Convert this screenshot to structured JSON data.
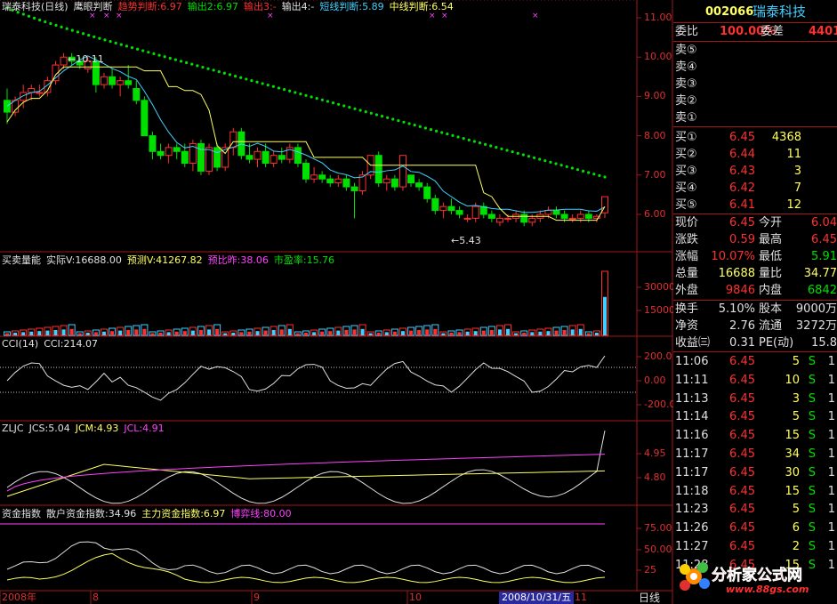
{
  "colors": {
    "up": "#ff3030",
    "down": "#00e000",
    "cyan": "#40d0ff",
    "yellow": "#ffff60",
    "magenta": "#ff40ff",
    "grid": "#a01818",
    "dots": "#00e000"
  },
  "main_panel": {
    "header": [
      {
        "text": "瑞泰科技(日线)",
        "color": "#e0e0e0"
      },
      {
        "text": "鹰眼判断",
        "color": "#e0e0e0"
      },
      {
        "text": "趋势判断:6.97",
        "color": "#ff3030"
      },
      {
        "text": "输出2:6.97",
        "color": "#00e000"
      },
      {
        "text": "输出3:-",
        "color": "#ff3030"
      },
      {
        "text": "输出4:-",
        "color": "#e0e0e0"
      },
      {
        "text": "短线判断:5.89",
        "color": "#40d0ff"
      },
      {
        "text": "中线判断:6.54",
        "color": "#ffff60"
      }
    ],
    "y_ticks": [
      "11.00",
      "10.00",
      "9.00",
      "8.00",
      "7.00",
      "6.00"
    ],
    "high_label": "10.11",
    "low_label": "5.43"
  },
  "volume_panel": {
    "header": [
      {
        "text": "买卖量能",
        "color": "#e0e0e0"
      },
      {
        "text": "实际V:16688.00",
        "color": "#e0e0e0"
      },
      {
        "text": "预测V:41267.82",
        "color": "#ffff60"
      },
      {
        "text": "预比昨:38.06",
        "color": "#ff40ff"
      },
      {
        "text": "市盈率:15.76",
        "color": "#00e000"
      }
    ],
    "y_ticks": [
      "30000",
      "15000"
    ]
  },
  "cci_panel": {
    "header": [
      {
        "text": "CCI(14)",
        "color": "#e0e0e0"
      },
      {
        "text": "CCI:214.07",
        "color": "#e0e0e0"
      }
    ],
    "y_ticks": [
      "200.0",
      "0.00",
      "-200.0"
    ]
  },
  "zljc_panel": {
    "header": [
      {
        "text": "ZLJC",
        "color": "#e0e0e0"
      },
      {
        "text": "JCS:5.04",
        "color": "#e0e0e0"
      },
      {
        "text": "JCM:4.93",
        "color": "#ffff60"
      },
      {
        "text": "JCL:4.91",
        "color": "#ff40ff"
      }
    ],
    "y_ticks": [
      "4.95",
      "4.80"
    ]
  },
  "fund_panel": {
    "header": [
      {
        "text": "资金指数",
        "color": "#e0e0e0"
      },
      {
        "text": "散户资金指数:34.96",
        "color": "#e0e0e0"
      },
      {
        "text": "主力资金指数:6.97",
        "color": "#ffff60"
      },
      {
        "text": "博弈线:80.00",
        "color": "#ff40ff"
      }
    ],
    "y_ticks": [
      "75.00",
      "50.00",
      "25"
    ]
  },
  "x_axis": {
    "labels": [
      "2008年",
      "8",
      "9",
      "10",
      "11"
    ],
    "cursor_date": "2008/10/31/五",
    "period_tab": "日线"
  },
  "quote": {
    "code": "002066",
    "name": "瑞泰科技",
    "weibi_label": "委比",
    "weibi_value": "100.00%",
    "weicha_label": "委差",
    "weicha_value": "4401",
    "asks": [
      {
        "label": "卖⑤",
        "price": "",
        "vol": ""
      },
      {
        "label": "卖④",
        "price": "",
        "vol": ""
      },
      {
        "label": "卖③",
        "price": "",
        "vol": ""
      },
      {
        "label": "卖②",
        "price": "",
        "vol": ""
      },
      {
        "label": "卖①",
        "price": "",
        "vol": ""
      }
    ],
    "bids": [
      {
        "label": "买①",
        "price": "6.45",
        "vol": "4368"
      },
      {
        "label": "买②",
        "price": "6.44",
        "vol": "11"
      },
      {
        "label": "买③",
        "price": "6.43",
        "vol": "3"
      },
      {
        "label": "买④",
        "price": "6.42",
        "vol": "7"
      },
      {
        "label": "买⑤",
        "price": "6.41",
        "vol": "12"
      }
    ],
    "stats": [
      {
        "l1": "现价",
        "v1": "6.45",
        "c1": "#ff3030",
        "l2": "今开",
        "v2": "6.04",
        "c2": "#ff3030"
      },
      {
        "l1": "涨跌",
        "v1": "0.59",
        "c1": "#ff3030",
        "l2": "最高",
        "v2": "6.45",
        "c2": "#ff3030"
      },
      {
        "l1": "涨幅",
        "v1": "10.07%",
        "c1": "#ff3030",
        "l2": "最低",
        "v2": "5.91",
        "c2": "#00e000"
      },
      {
        "l1": "总量",
        "v1": "16688",
        "c1": "#ffff60",
        "l2": "量比",
        "v2": "34.77",
        "c2": "#ffff60"
      },
      {
        "l1": "外盘",
        "v1": "9846",
        "c1": "#ff3030",
        "l2": "内盘",
        "v2": "6842",
        "c2": "#00e000"
      }
    ],
    "stats2": [
      {
        "l1": "换手",
        "v1": "5.10%",
        "l2": "股本",
        "v2": "9000万"
      },
      {
        "l1": "净资",
        "v1": "2.76",
        "l2": "流通",
        "v2": "3272万"
      },
      {
        "l1": "收益㈢",
        "v1": "0.31",
        "l2": "PE(动)",
        "v2": "15.8"
      }
    ],
    "ticks": [
      {
        "time": "11:06",
        "price": "6.45",
        "vol": "5",
        "bs": "S",
        "n": "1"
      },
      {
        "time": "11:11",
        "price": "6.45",
        "vol": "10",
        "bs": "S",
        "n": "1"
      },
      {
        "time": "11:13",
        "price": "6.45",
        "vol": "3",
        "bs": "S",
        "n": "1"
      },
      {
        "time": "11:14",
        "price": "6.45",
        "vol": "5",
        "bs": "S",
        "n": "1"
      },
      {
        "time": "11:16",
        "price": "6.45",
        "vol": "15",
        "bs": "S",
        "n": "1"
      },
      {
        "time": "11:17",
        "price": "6.45",
        "vol": "34",
        "bs": "S",
        "n": "1"
      },
      {
        "time": "11:17",
        "price": "6.45",
        "vol": "30",
        "bs": "S",
        "n": "1"
      },
      {
        "time": "11:18",
        "price": "6.45",
        "vol": "15",
        "bs": "S",
        "n": "1"
      },
      {
        "time": "11:23",
        "price": "6.45",
        "vol": "5",
        "bs": "S",
        "n": "1"
      },
      {
        "time": "11:26",
        "price": "6.45",
        "vol": "6",
        "bs": "S",
        "n": "1"
      },
      {
        "time": "11:27",
        "price": "6.45",
        "vol": "2",
        "bs": "S",
        "n": "1"
      },
      {
        "time": "11:28",
        "price": "6.45",
        "vol": "15",
        "bs": "S",
        "n": "1"
      }
    ],
    "logo_text": "分析家公式网",
    "logo_url": "www.88gs.com"
  },
  "chart_data": {
    "type": "candlestick",
    "candles": [
      [
        8.9,
        9.2,
        8.3,
        8.6
      ],
      [
        8.6,
        9.0,
        8.5,
        8.9
      ],
      [
        8.9,
        9.3,
        8.7,
        9.1
      ],
      [
        9.1,
        9.3,
        8.9,
        9.2
      ],
      [
        9.1,
        9.3,
        9.0,
        9.1
      ],
      [
        9.1,
        9.5,
        9.0,
        9.4
      ],
      [
        9.4,
        9.9,
        9.3,
        9.8
      ],
      [
        9.8,
        10.1,
        9.7,
        10.0
      ],
      [
        10.0,
        10.1,
        9.8,
        9.9
      ],
      [
        9.9,
        10.0,
        9.7,
        9.8
      ],
      [
        9.7,
        10.0,
        9.6,
        9.9
      ],
      [
        9.9,
        10.0,
        9.1,
        9.3
      ],
      [
        9.3,
        9.6,
        9.2,
        9.5
      ],
      [
        9.5,
        9.7,
        9.2,
        9.3
      ],
      [
        9.3,
        9.5,
        9.0,
        9.4
      ],
      [
        9.4,
        9.8,
        9.2,
        9.3
      ],
      [
        9.2,
        9.4,
        8.8,
        8.9
      ],
      [
        8.9,
        9.0,
        8.0,
        8.0
      ],
      [
        8.0,
        8.1,
        7.4,
        7.6
      ],
      [
        7.6,
        7.8,
        7.4,
        7.5
      ],
      [
        7.5,
        7.8,
        7.3,
        7.7
      ],
      [
        7.7,
        7.8,
        7.4,
        7.6
      ],
      [
        7.6,
        7.8,
        7.2,
        7.3
      ],
      [
        7.3,
        7.9,
        7.1,
        7.8
      ],
      [
        7.8,
        7.9,
        7.0,
        7.1
      ],
      [
        7.1,
        7.8,
        7.0,
        7.7
      ],
      [
        7.7,
        7.8,
        7.1,
        7.2
      ],
      [
        7.2,
        7.8,
        7.1,
        7.7
      ],
      [
        7.7,
        8.2,
        7.5,
        8.1
      ],
      [
        8.1,
        8.2,
        7.4,
        7.5
      ],
      [
        7.5,
        7.8,
        7.3,
        7.4
      ],
      [
        7.4,
        7.7,
        7.2,
        7.6
      ],
      [
        7.6,
        7.8,
        7.2,
        7.3
      ],
      [
        7.3,
        7.6,
        7.2,
        7.5
      ],
      [
        7.5,
        7.7,
        7.3,
        7.4
      ],
      [
        7.4,
        7.8,
        7.3,
        7.7
      ],
      [
        7.7,
        7.8,
        7.2,
        7.3
      ],
      [
        7.3,
        7.4,
        6.8,
        6.9
      ],
      [
        6.9,
        7.2,
        6.8,
        7.0
      ],
      [
        7.0,
        7.1,
        6.8,
        6.9
      ],
      [
        6.9,
        7.0,
        6.7,
        6.8
      ],
      [
        6.8,
        7.0,
        6.7,
        6.9
      ],
      [
        6.9,
        7.0,
        6.6,
        6.7
      ],
      [
        6.7,
        6.8,
        5.9,
        6.6
      ],
      [
        6.6,
        7.1,
        6.5,
        7.0
      ],
      [
        7.0,
        7.5,
        6.9,
        7.5
      ],
      [
        7.5,
        7.6,
        6.7,
        6.8
      ],
      [
        6.8,
        7.0,
        6.6,
        6.9
      ],
      [
        6.9,
        7.0,
        6.6,
        6.7
      ],
      [
        6.7,
        7.5,
        6.6,
        7.5
      ],
      [
        7.0,
        7.0,
        6.7,
        6.8
      ],
      [
        6.8,
        6.9,
        6.6,
        6.7
      ],
      [
        6.7,
        6.8,
        6.3,
        6.4
      ],
      [
        6.4,
        6.5,
        6.0,
        6.1
      ],
      [
        6.1,
        6.3,
        5.9,
        6.2
      ],
      [
        6.2,
        6.4,
        6.0,
        6.1
      ],
      [
        6.1,
        6.2,
        5.9,
        6.0
      ],
      [
        5.9,
        6.0,
        5.8,
        5.9
      ],
      [
        5.9,
        6.3,
        5.8,
        6.2
      ],
      [
        6.2,
        6.3,
        5.9,
        6.0
      ],
      [
        6.0,
        6.1,
        5.8,
        5.9
      ],
      [
        5.8,
        6.0,
        5.7,
        5.9
      ],
      [
        5.9,
        6.0,
        5.8,
        5.9
      ],
      [
        5.9,
        6.1,
        5.8,
        6.0
      ],
      [
        6.0,
        6.1,
        5.7,
        5.8
      ],
      [
        5.8,
        6.0,
        5.7,
        5.9
      ],
      [
        5.9,
        6.1,
        5.8,
        6.0
      ],
      [
        6.0,
        6.2,
        5.9,
        6.1
      ],
      [
        6.1,
        6.2,
        5.9,
        6.0
      ],
      [
        6.0,
        6.1,
        5.8,
        5.9
      ],
      [
        5.9,
        6.0,
        5.8,
        5.9
      ],
      [
        5.9,
        6.1,
        5.8,
        6.0
      ],
      [
        6.0,
        6.1,
        5.8,
        5.9
      ],
      [
        5.9,
        6.0,
        5.8,
        5.95
      ],
      [
        6.04,
        6.45,
        5.91,
        6.45
      ]
    ]
  }
}
